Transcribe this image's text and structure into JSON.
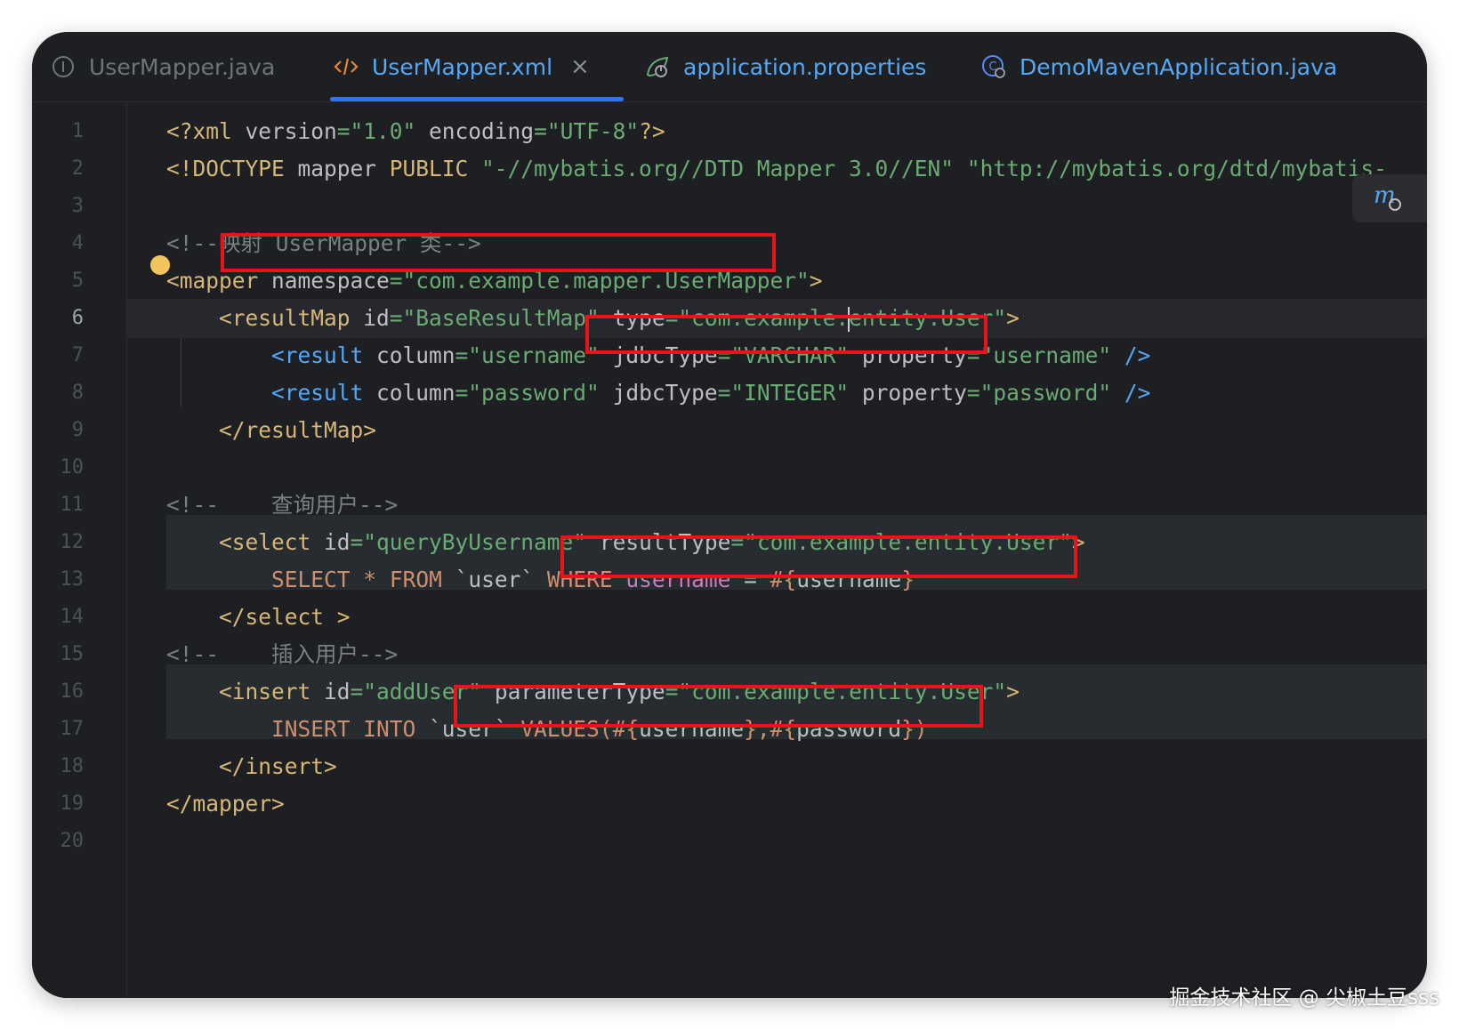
{
  "tabs": [
    {
      "label": "UserMapper.java",
      "icon": "interface-icon",
      "color": "#6f737a"
    },
    {
      "label": "UserMapper.xml",
      "icon": "xml-icon",
      "color": "#56a8f5",
      "close": "×"
    },
    {
      "label": "application.properties",
      "icon": "spring-properties-icon",
      "color": "#56a8f5"
    },
    {
      "label": "DemoMavenApplication.java",
      "icon": "spring-app-icon",
      "color": "#56a8f5"
    }
  ],
  "editor": {
    "current_line": 6,
    "line_numbers": [
      "1",
      "2",
      "3",
      "4",
      "5",
      "6",
      "7",
      "8",
      "9",
      "10",
      "11",
      "12",
      "13",
      "14",
      "15",
      "16",
      "17",
      "18",
      "19",
      "20"
    ],
    "lines": [
      [
        [
          "t",
          "<?xml "
        ],
        [
          "an",
          "version"
        ],
        [
          "av",
          "=\"1.0\""
        ],
        [
          "an",
          " encoding"
        ],
        [
          "av",
          "=\"UTF-8\""
        ],
        [
          "t",
          "?>"
        ]
      ],
      [
        [
          "t",
          "<!DOCTYPE "
        ],
        [
          "an",
          "mapper"
        ],
        [
          "t",
          " PUBLIC "
        ],
        [
          "av",
          "\"-//mybatis.org//DTD Mapper 3.0//EN\""
        ],
        [
          "an",
          " "
        ],
        [
          "av",
          "\"http://mybatis.org/dtd/mybatis-"
        ]
      ],
      [],
      [
        [
          "cm",
          "<!--映射 UserMapper 类-->"
        ]
      ],
      [
        [
          "t",
          "<mapper"
        ],
        [
          "an",
          " namespace"
        ],
        [
          "av",
          "=\"com.example.mapper.UserMapper\""
        ],
        [
          "t",
          ">"
        ]
      ],
      [
        [
          "an",
          "    "
        ],
        [
          "t",
          "<resultMap"
        ],
        [
          "an",
          " id"
        ],
        [
          "av",
          "=\"BaseResultMap\""
        ],
        [
          "an",
          " type"
        ],
        [
          "av",
          "=\"com.example."
        ],
        [
          "av",
          "entity.User\""
        ],
        [
          "t",
          ">"
        ]
      ],
      [
        [
          "an",
          "        "
        ],
        [
          "bl",
          "<result"
        ],
        [
          "an",
          " column"
        ],
        [
          "av",
          "=\"username\""
        ],
        [
          "an",
          " jdbcType"
        ],
        [
          "av",
          "=\"VARCHAR\""
        ],
        [
          "an",
          " property"
        ],
        [
          "av",
          "=\"username\""
        ],
        [
          "bl",
          " />"
        ]
      ],
      [
        [
          "an",
          "        "
        ],
        [
          "bl",
          "<result"
        ],
        [
          "an",
          " column"
        ],
        [
          "av",
          "=\"password\""
        ],
        [
          "an",
          " jdbcType"
        ],
        [
          "av",
          "=\"INTEGER\""
        ],
        [
          "an",
          " property"
        ],
        [
          "av",
          "=\"password\""
        ],
        [
          "bl",
          " />"
        ]
      ],
      [
        [
          "an",
          "    "
        ],
        [
          "t",
          "</resultMap>"
        ]
      ],
      [],
      [
        [
          "cm",
          "<!--    查询用户-->"
        ]
      ],
      [
        [
          "an",
          "    "
        ],
        [
          "t",
          "<select"
        ],
        [
          "an",
          " id"
        ],
        [
          "av",
          "=\"queryByUsername\""
        ],
        [
          "an",
          " resultType"
        ],
        [
          "av",
          "=\"com.example.entity.User\""
        ],
        [
          "t",
          ">"
        ]
      ],
      [
        [
          "an",
          "        "
        ],
        [
          "kw",
          "SELECT"
        ],
        [
          "pl",
          " "
        ],
        [
          "kw",
          "*"
        ],
        [
          "pl",
          " "
        ],
        [
          "kw",
          "FROM"
        ],
        [
          "pl",
          " `user` "
        ],
        [
          "kw",
          "WHERE"
        ],
        [
          "pl",
          " "
        ],
        [
          "fn",
          "username"
        ],
        [
          "pl",
          " = "
        ],
        [
          "kw",
          "#{"
        ],
        [
          "pl",
          "username"
        ],
        [
          "kw",
          "}"
        ]
      ],
      [
        [
          "an",
          "    "
        ],
        [
          "t",
          "</select >"
        ]
      ],
      [
        [
          "cm",
          "<!--    插入用户-->"
        ]
      ],
      [
        [
          "an",
          "    "
        ],
        [
          "t",
          "<insert"
        ],
        [
          "an",
          " id"
        ],
        [
          "av",
          "=\"addUser\""
        ],
        [
          "an",
          " parameterType"
        ],
        [
          "av",
          "=\"com.example.entity.User\""
        ],
        [
          "t",
          ">"
        ]
      ],
      [
        [
          "an",
          "        "
        ],
        [
          "kw",
          "INSERT INTO"
        ],
        [
          "pl",
          " `user` "
        ],
        [
          "kw",
          "VALUES("
        ],
        [
          "kw",
          "#{"
        ],
        [
          "pl",
          "username"
        ],
        [
          "kw",
          "}"
        ],
        [
          "kw",
          ","
        ],
        [
          "kw",
          "#{"
        ],
        [
          "pl",
          "password"
        ],
        [
          "kw",
          "})"
        ]
      ],
      [
        [
          "an",
          "    "
        ],
        [
          "t",
          "</insert>"
        ]
      ],
      [
        [
          "t",
          "</mapper>"
        ]
      ],
      []
    ]
  },
  "float_button_icon": "maven-reload-icon",
  "watermark": "掘金技术社区 @ 尖椒土豆sss",
  "colors": {
    "highlight_box": "#e8141a",
    "tab_underline": "#3574f0",
    "background": "#1e1f22"
  }
}
